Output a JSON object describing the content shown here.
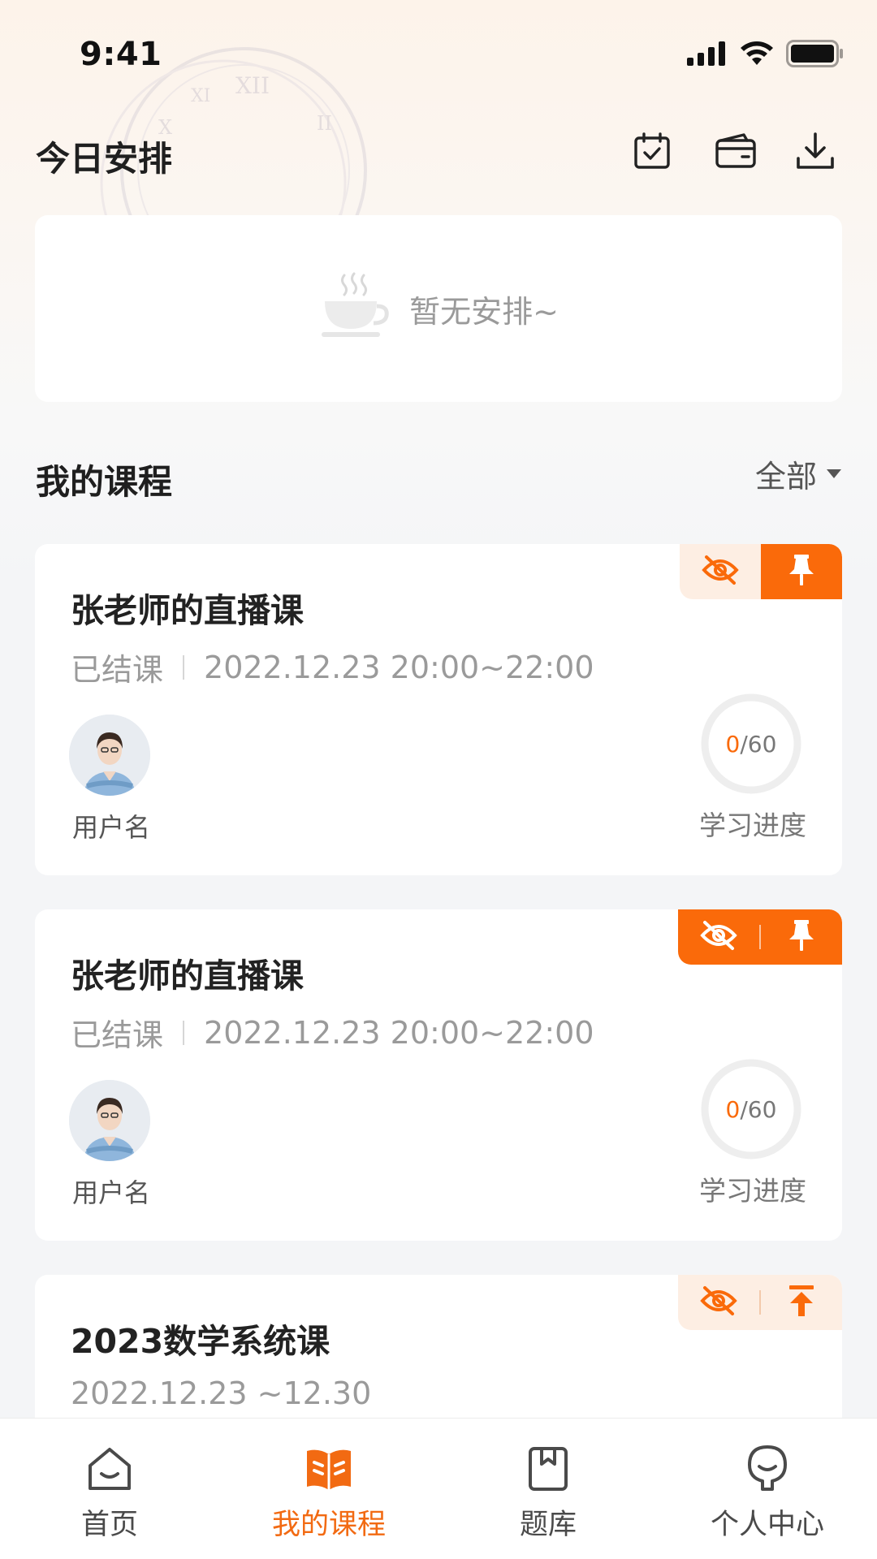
{
  "status_bar": {
    "time": "9:41",
    "signal_icon": "signal-icon",
    "wifi_icon": "wifi-icon",
    "battery_icon": "battery-icon"
  },
  "header": {
    "title": "今日安排",
    "actions": [
      {
        "icon": "calendar-check-icon"
      },
      {
        "icon": "wallet-icon"
      },
      {
        "icon": "download-icon"
      }
    ]
  },
  "schedule": {
    "empty_icon": "coffee-cup-icon",
    "empty_text": "暂无安排~"
  },
  "courses_section": {
    "title": "我的课程",
    "filter_label": "全部"
  },
  "courses": [
    {
      "title": "张老师的直播课",
      "status": "已结课",
      "time": "2022.12.23 20:00~22:00",
      "teacher": "用户名",
      "progress_current": "0",
      "progress_total": "/60",
      "progress_label": "学习进度",
      "actions": [
        "hide-icon",
        "pin-icon"
      ]
    },
    {
      "title": "张老师的直播课",
      "status": "已结课",
      "time": "2022.12.23 20:00~22:00",
      "teacher": "用户名",
      "progress_current": "0",
      "progress_total": "/60",
      "progress_label": "学习进度",
      "actions": [
        "hide-icon",
        "pin-icon"
      ]
    },
    {
      "title": "2023数学系统课",
      "time": "2022.12.23 ~12.30",
      "actions": [
        "hide-icon",
        "move-to-top-icon"
      ]
    }
  ],
  "bottom_nav": [
    {
      "label": "首页",
      "icon": "home-icon"
    },
    {
      "label": "我的课程",
      "icon": "open-book-icon",
      "active": true
    },
    {
      "label": "题库",
      "icon": "question-bank-icon"
    },
    {
      "label": "个人中心",
      "icon": "user-center-icon"
    }
  ],
  "colors": {
    "accent": "#fa6a0a",
    "accent_light": "#fdeee3",
    "text_primary": "#222222",
    "text_secondary": "#9a9a9a"
  }
}
